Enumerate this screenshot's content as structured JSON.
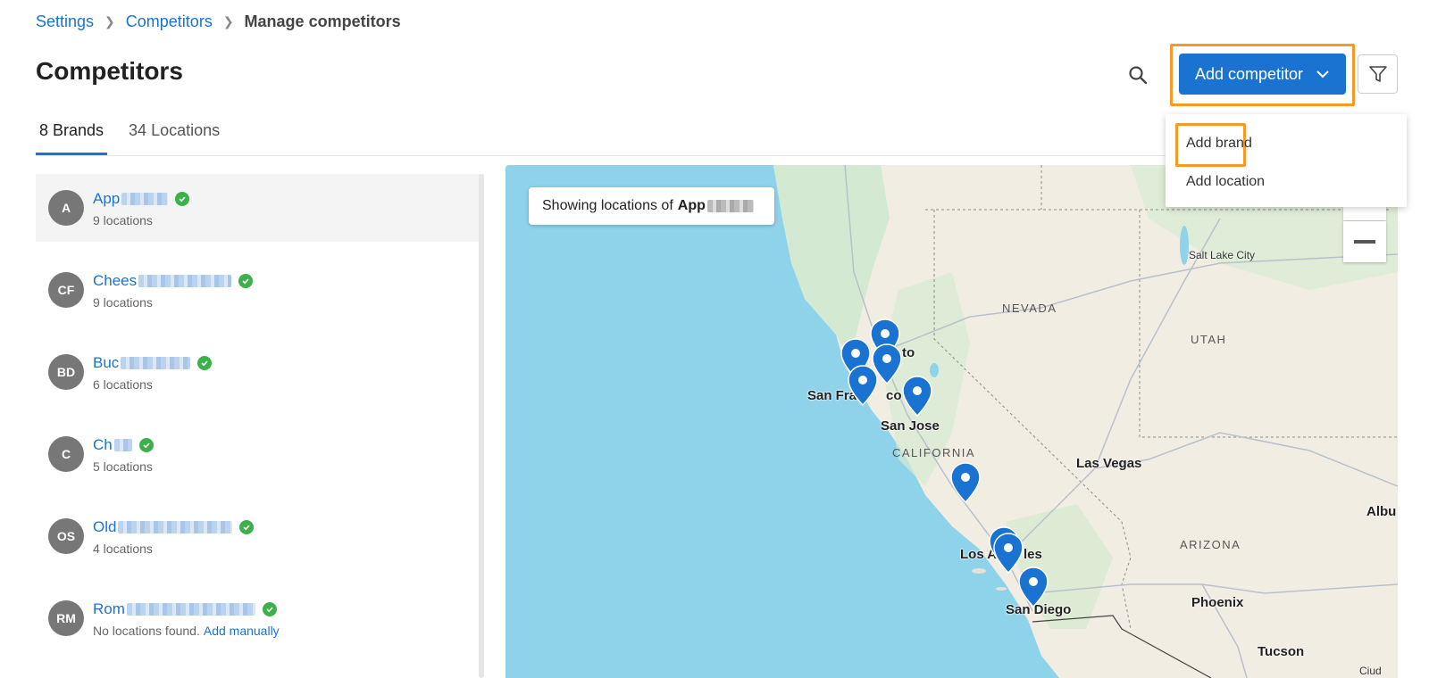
{
  "breadcrumb": {
    "items": [
      "Settings",
      "Competitors"
    ],
    "current": "Manage competitors"
  },
  "page": {
    "title": "Competitors"
  },
  "header": {
    "add_button": "Add competitor"
  },
  "dropdown": {
    "items": [
      "Add brand",
      "Add location"
    ]
  },
  "tabs": [
    {
      "label": "8 Brands",
      "active": true
    },
    {
      "label": "34 Locations",
      "active": false
    }
  ],
  "brands": [
    {
      "initials": "A",
      "name": "App",
      "sub": "9 locations",
      "link": ""
    },
    {
      "initials": "CF",
      "name": "Chees",
      "sub": "9 locations",
      "link": ""
    },
    {
      "initials": "BD",
      "name": "Buc",
      "sub": "6 locations",
      "link": ""
    },
    {
      "initials": "C",
      "name": "Ch",
      "sub": "5 locations",
      "link": ""
    },
    {
      "initials": "OS",
      "name": "Old",
      "sub": "4 locations",
      "link": ""
    },
    {
      "initials": "RM",
      "name": "Rom",
      "sub": "No locations found.",
      "link": "Add manually"
    }
  ],
  "map": {
    "card_prefix": "Showing locations of",
    "card_brand": "App",
    "labels": {
      "sacramento": "to",
      "sf": "San Fra",
      "sf2": "co",
      "san_jose": "San Jose",
      "california": "CALIFORNIA",
      "nevada": "NEVADA",
      "utah": "UTAH",
      "arizona": "ARIZONA",
      "las_vegas": "Las Vegas",
      "salt_lake": "Salt Lake City",
      "los_angeles": "Los A",
      "los_angeles2": "les",
      "san_diego": "San Diego",
      "phoenix": "Phoenix",
      "tucson": "Tucson",
      "albu": "Albu",
      "ciud": "Ciud"
    }
  },
  "colors": {
    "accent": "#1a73d1",
    "highlight": "#f59a23",
    "verified": "#3cb04a",
    "water": "#8fd3ea",
    "land": "#f2ede3"
  }
}
